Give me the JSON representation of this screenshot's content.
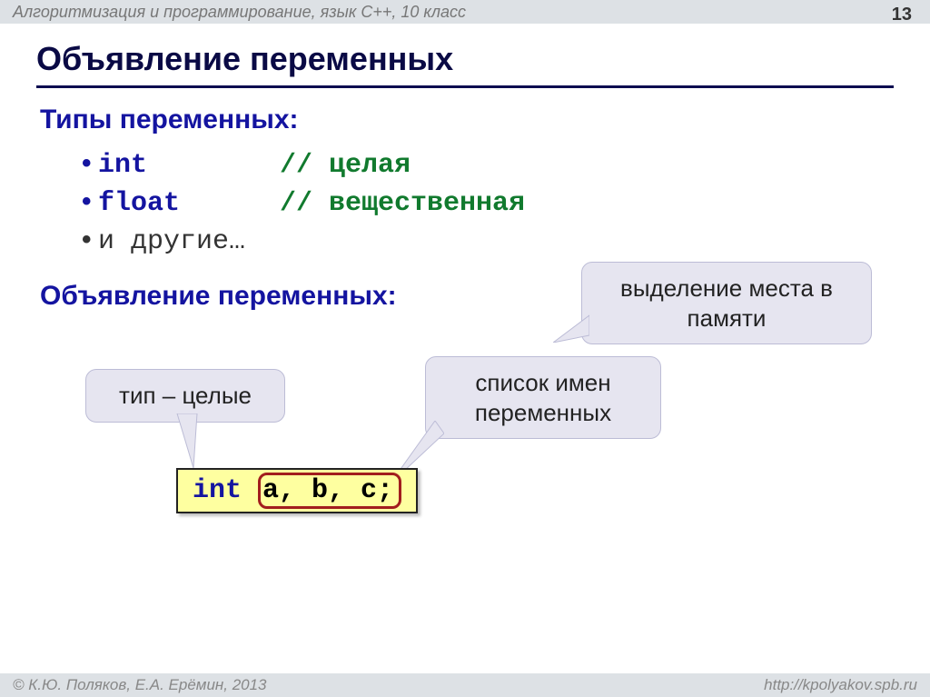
{
  "header": {
    "title": "Алгоритмизация и программирование, язык  C++, 10 класс",
    "page": "13"
  },
  "slide_title": "Объявление  переменных",
  "types": {
    "heading": "Типы переменных:",
    "rows": [
      {
        "kw": "int",
        "comment": "// целая"
      },
      {
        "kw": "float",
        "comment": "// вещественная"
      }
    ],
    "others": "и другие…"
  },
  "decl_heading": "Объявление переменных:",
  "callouts": {
    "memory": "выделение места в памяти",
    "type": "тип – целые",
    "list": "список имен переменных"
  },
  "code": {
    "kw": "int ",
    "vars": "a, b, c;"
  },
  "footer": {
    "left": "© К.Ю. Поляков, Е.А. Ерёмин, 2013",
    "right": "http://kpolyakov.spb.ru"
  }
}
